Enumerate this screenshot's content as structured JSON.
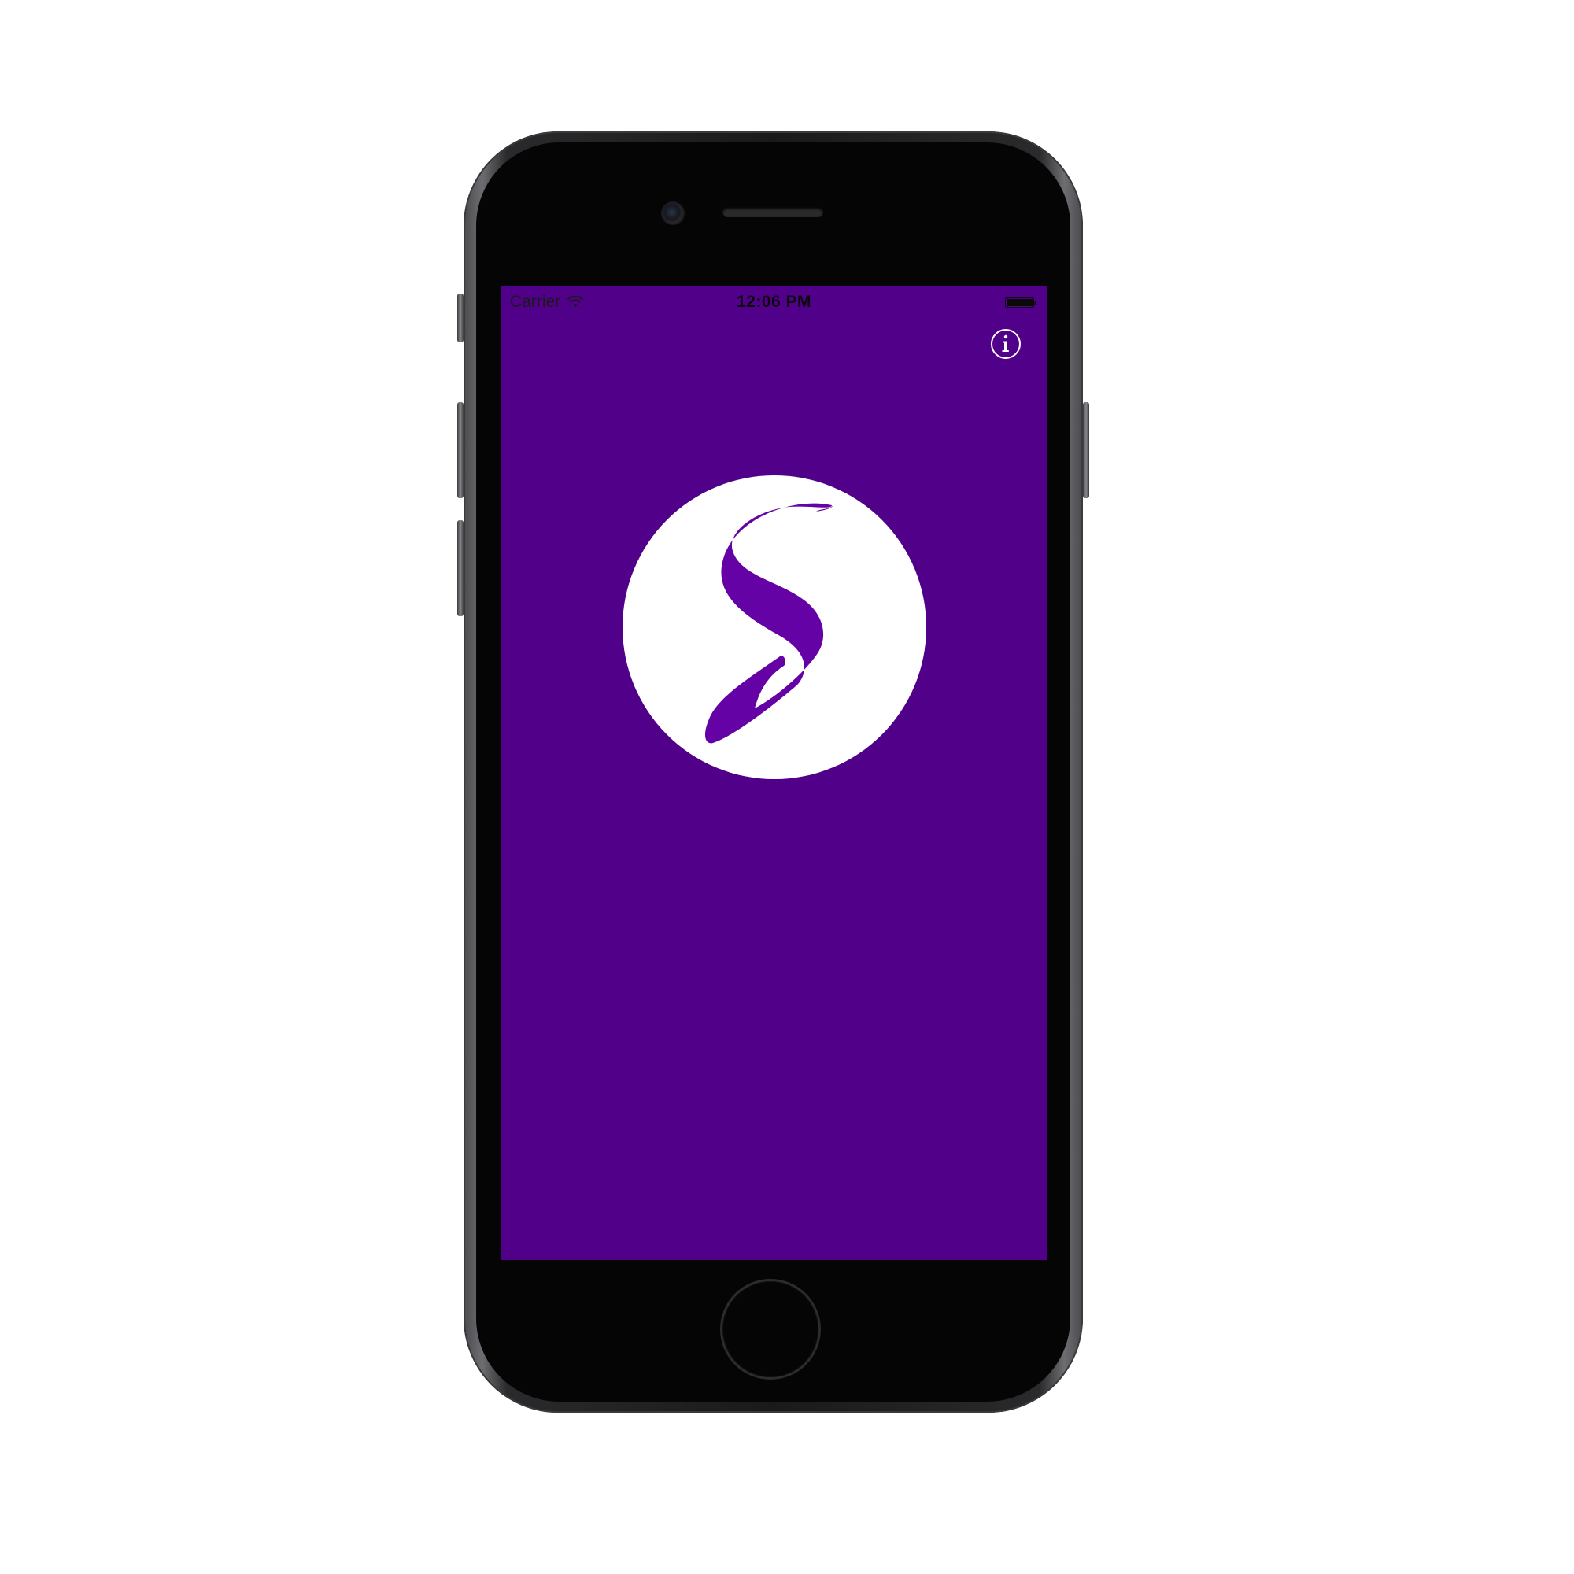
{
  "status_bar": {
    "carrier": "Carrier",
    "time": "12:06 PM",
    "wifi_icon": "wifi-icon",
    "battery_icon": "battery-icon"
  },
  "screen": {
    "background_color": "#51008a",
    "info_icon": "info-icon",
    "logo_icon": "s-logo-icon",
    "logo_circle_color": "#ffffff",
    "logo_glyph_color": "#6502a5"
  },
  "device": {
    "model": "iPhone",
    "color": "space-gray"
  }
}
